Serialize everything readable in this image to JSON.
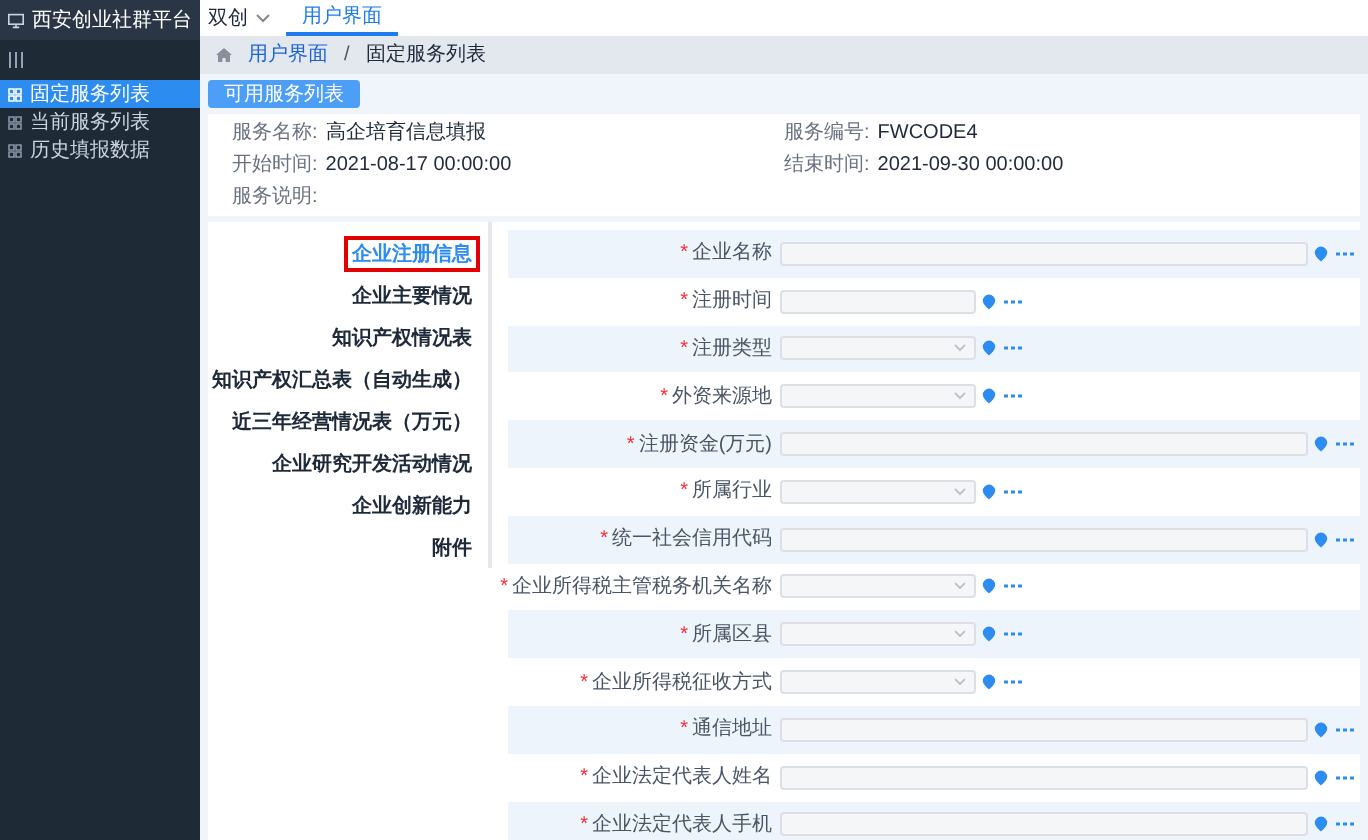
{
  "app": {
    "title": "西安创业社群平台"
  },
  "sidebar": {
    "items": [
      {
        "label": "固定服务列表",
        "selected": true
      },
      {
        "label": "当前服务列表",
        "selected": false
      },
      {
        "label": "历史填报数据",
        "selected": false
      }
    ]
  },
  "header": {
    "menu": "双创",
    "tabs": [
      {
        "label": "用户界面",
        "selected": true
      }
    ]
  },
  "breadcrumb": {
    "items": [
      "用户界面",
      "固定服务列表"
    ],
    "separator": "/"
  },
  "action_button": "可用服务列表",
  "service_info": [
    {
      "label": "服务名称:",
      "value": "高企培育信息填报"
    },
    {
      "label": "服务编号:",
      "value": "FWCODE4"
    },
    {
      "label": "开始时间:",
      "value": "2021-08-17 00:00:00"
    },
    {
      "label": "结束时间:",
      "value": "2021-09-30 00:00:00"
    },
    {
      "label": "服务说明:"
    }
  ],
  "sections": [
    {
      "label": "企业注册信息",
      "selected": true,
      "highlighted": true
    },
    {
      "label": "企业主要情况",
      "selected": false,
      "highlighted": false
    },
    {
      "label": "知识产权情况表",
      "selected": false,
      "highlighted": false
    },
    {
      "label": "知识产权汇总表（自动生成）",
      "selected": false,
      "highlighted": false
    },
    {
      "label": "近三年经营情况表（万元）",
      "selected": false,
      "highlighted": false
    },
    {
      "label": "企业研究开发活动情况",
      "selected": false,
      "highlighted": false
    },
    {
      "label": "企业创新能力",
      "selected": false,
      "highlighted": false
    },
    {
      "label": "附件",
      "selected": false,
      "highlighted": false
    }
  ],
  "fields": [
    {
      "required_mark": "*",
      "label": "企业名称",
      "kind": "input",
      "wide": true
    },
    {
      "required_mark": "*",
      "label": "注册时间",
      "kind": "input",
      "wide": false
    },
    {
      "required_mark": "*",
      "label": "注册类型",
      "kind": "select",
      "wide": false
    },
    {
      "required_mark": "*",
      "label": "外资来源地",
      "kind": "select",
      "wide": false
    },
    {
      "required_mark": "*",
      "label": "注册资金(万元)",
      "kind": "input",
      "wide": true
    },
    {
      "required_mark": "*",
      "label": "所属行业",
      "kind": "select",
      "wide": false
    },
    {
      "required_mark": "*",
      "label": "统一社会信用代码",
      "kind": "input",
      "wide": true
    },
    {
      "required_mark": "*",
      "label": "企业所得税主管税务机关名称",
      "kind": "select",
      "wide": false
    },
    {
      "required_mark": "*",
      "label": "所属区县",
      "kind": "select",
      "wide": false
    },
    {
      "required_mark": "*",
      "label": "企业所得税征收方式",
      "kind": "select",
      "wide": false
    },
    {
      "required_mark": "*",
      "label": "通信地址",
      "kind": "input",
      "wide": true
    },
    {
      "required_mark": "*",
      "label": "企业法定代表人姓名",
      "kind": "input",
      "wide": true
    },
    {
      "required_mark": "*",
      "label": "企业法定代表人手机",
      "kind": "input",
      "wide": true
    }
  ]
}
